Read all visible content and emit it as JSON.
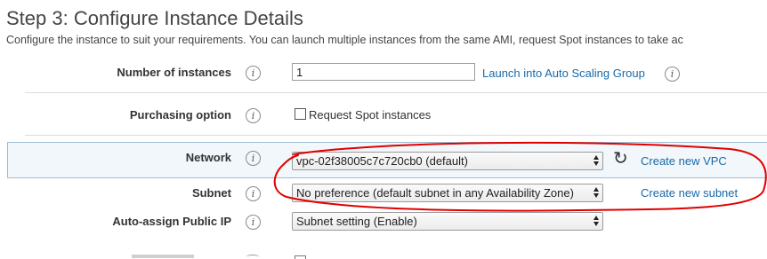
{
  "header": {
    "title": "Step 3: Configure Instance Details",
    "subtitle": "Configure the instance to suit your requirements. You can launch multiple instances from the same AMI, request Spot instances to take ac"
  },
  "info_glyph": "i",
  "rows": {
    "num_instances": {
      "label": "Number of instances",
      "value": "1",
      "link": "Launch into Auto Scaling Group"
    },
    "purchasing": {
      "label": "Purchasing option",
      "checkbox_label": "Request Spot instances",
      "checked": false
    },
    "network": {
      "label": "Network",
      "selected": "vpc-02f38005c7c720cb0 (default)",
      "link": "Create new VPC"
    },
    "subnet": {
      "label": "Subnet",
      "selected": "No preference (default subnet in any Availability Zone)",
      "link": "Create new subnet"
    },
    "public_ip": {
      "label": "Auto-assign Public IP",
      "selected": "Subnet setting (Enable)"
    }
  },
  "colors": {
    "link": "#1a6aa8",
    "highlight_band": "#f1f7fb",
    "annotation": "#e00000"
  },
  "icons": [
    "info-icon",
    "refresh-icon",
    "select-arrows-icon"
  ]
}
